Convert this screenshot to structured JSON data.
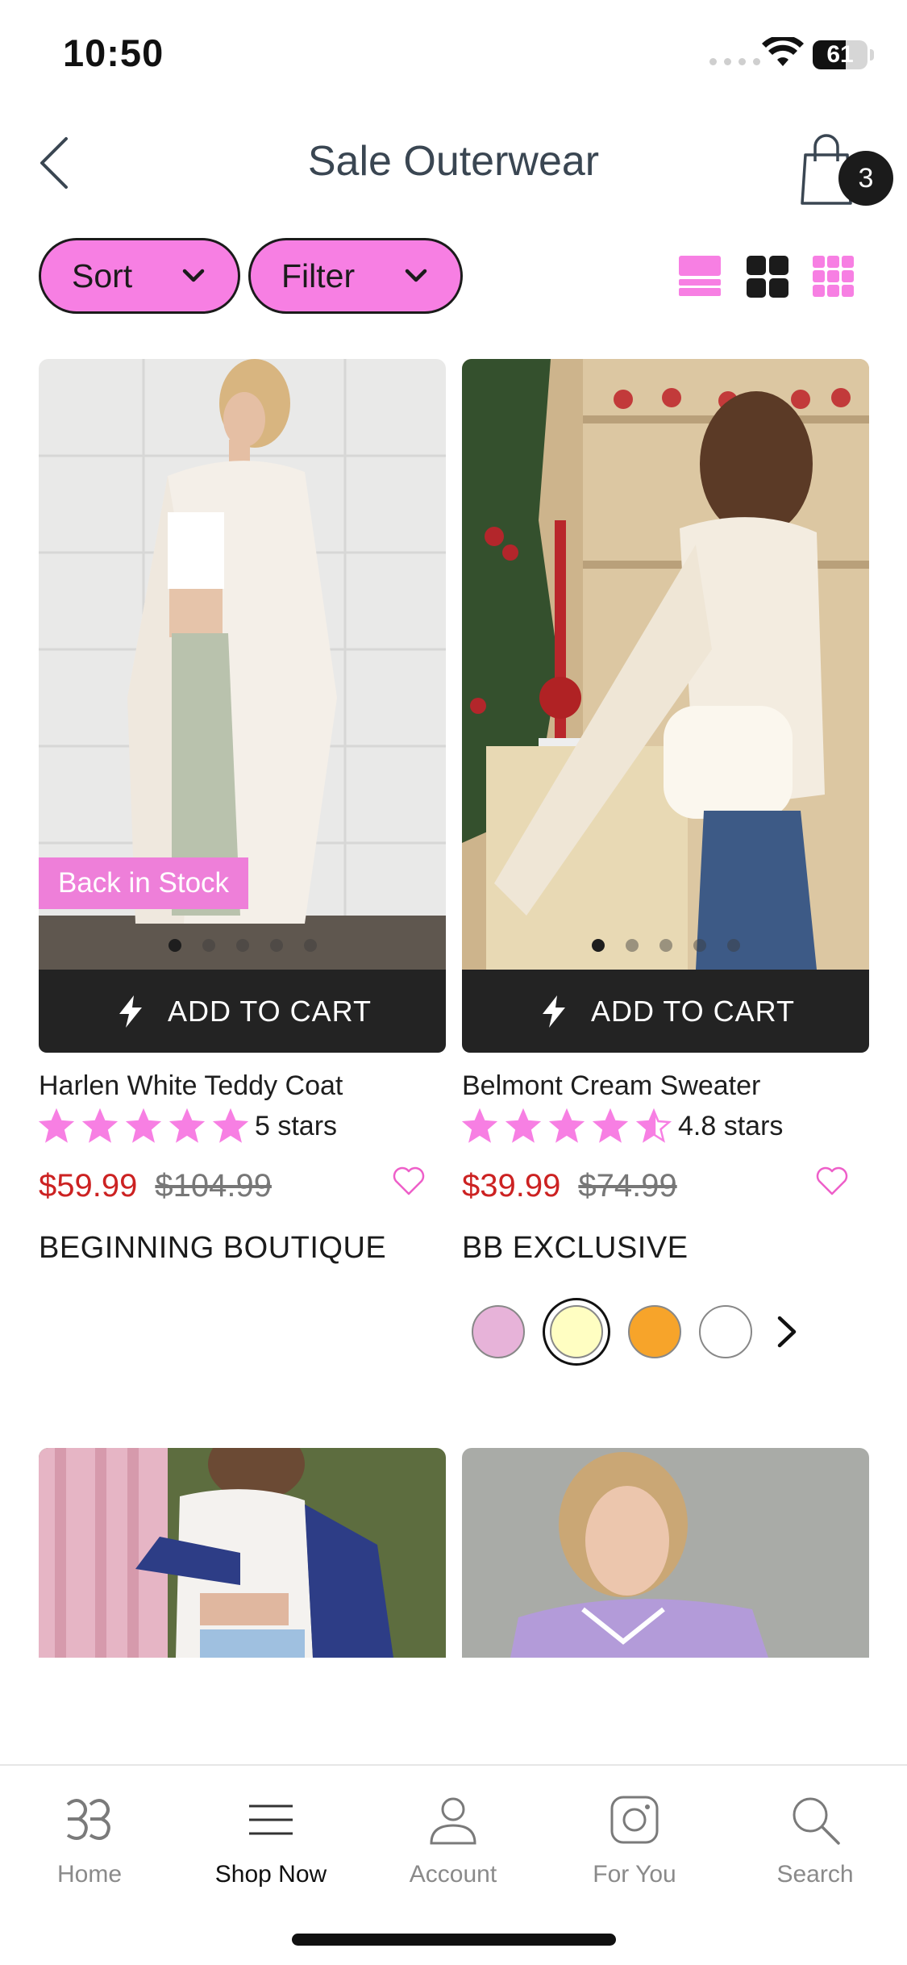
{
  "status_bar": {
    "time": "10:50",
    "battery_level": "61",
    "battery_fraction": 0.61
  },
  "header": {
    "title": "Sale Outerwear",
    "cart_count": "3"
  },
  "controls": {
    "sort_label": "Sort",
    "filter_label": "Filter",
    "view_options": [
      "single-column-view-icon",
      "two-column-grid-icon",
      "three-column-grid-icon"
    ],
    "active_view": "two-column-grid-icon"
  },
  "products": [
    {
      "name": "Harlen White Teddy Coat",
      "rating_text": "5 stars",
      "rating_value": 5,
      "sale_price": "$59.99",
      "original_price": "$104.99",
      "brand": "BEGINNING BOUTIQUE",
      "badge": "Back in Stock",
      "add_to_cart": "ADD TO CART",
      "image_count": 5,
      "active_image": 1
    },
    {
      "name": "Belmont Cream Sweater",
      "rating_text": "4.8 stars",
      "rating_value": 4.8,
      "sale_price": "$39.99",
      "original_price": "$74.99",
      "brand": "BB EXCLUSIVE",
      "add_to_cart": "ADD TO CART",
      "image_count": 5,
      "active_image": 1,
      "swatches": [
        "#e7b3d9",
        "#fffec2",
        "#f7a42a",
        "#ffffff"
      ],
      "selected_swatch": 1
    }
  ],
  "tabbar": {
    "items": [
      {
        "label": "Home",
        "icon": "brand-logo-icon"
      },
      {
        "label": "Shop Now",
        "icon": "menu-icon"
      },
      {
        "label": "Account",
        "icon": "account-icon"
      },
      {
        "label": "For You",
        "icon": "instagram-icon"
      },
      {
        "label": "Search",
        "icon": "search-icon"
      }
    ],
    "active": "Shop Now"
  },
  "colors": {
    "accent_pink": "#f77fe3",
    "sale_red": "#cc2222",
    "dark": "#232323"
  }
}
